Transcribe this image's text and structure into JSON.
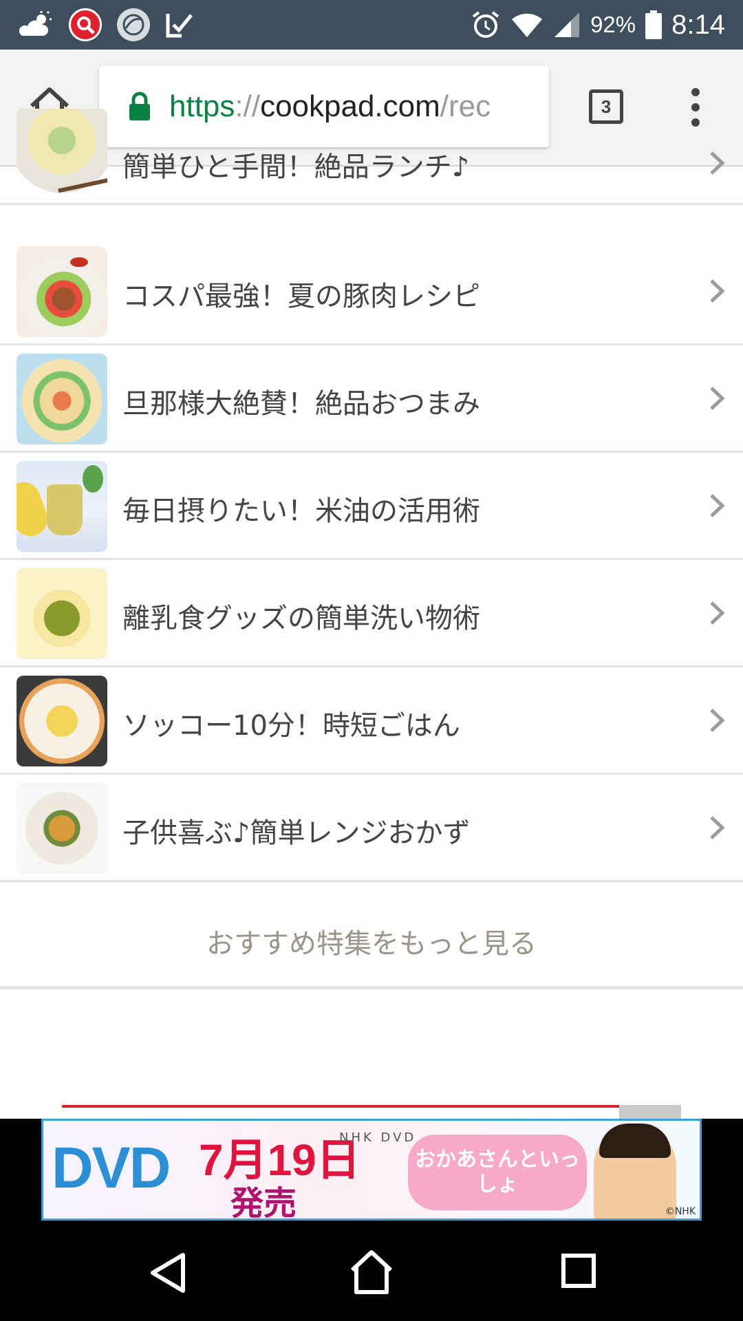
{
  "status_bar": {
    "battery_percent": "92%",
    "time": "8:14",
    "icons": [
      "weather-icon",
      "search-app-icon",
      "browser-app-icon",
      "check-app-icon",
      "alarm-icon",
      "wifi-icon",
      "signal-icon",
      "battery-icon"
    ]
  },
  "toolbar": {
    "url_scheme": "https",
    "url_separator": "://",
    "url_host": "cookpad.com",
    "url_path": "/rec",
    "tab_count": "3"
  },
  "list": {
    "items": [
      {
        "label": "簡単ひと手間！絶品ランチ♪"
      },
      {
        "label": "コスパ最強！夏の豚肉レシピ"
      },
      {
        "label": "旦那様大絶賛！絶品おつまみ"
      },
      {
        "label": "毎日摂りたい！米油の活用術"
      },
      {
        "label": "離乳食グッズの簡単洗い物術"
      },
      {
        "label": "ソッコー10分！時短ごはん"
      },
      {
        "label": "子供喜ぶ♪簡単レンジおかず"
      }
    ],
    "more_label": "おすすめ特集をもっと見る"
  },
  "ad": {
    "dvd": "DVD",
    "date": "7月19日",
    "release": "発売",
    "logo": "NHK DVD",
    "title": "おかあさんといっしょ",
    "copyright": "©NHK"
  },
  "colors": {
    "status_bar": "#3e4e5c",
    "toolbar": "#f2f2f2",
    "secure_green": "#0b8043",
    "list_text": "#444444",
    "more_text": "#9a938a"
  }
}
